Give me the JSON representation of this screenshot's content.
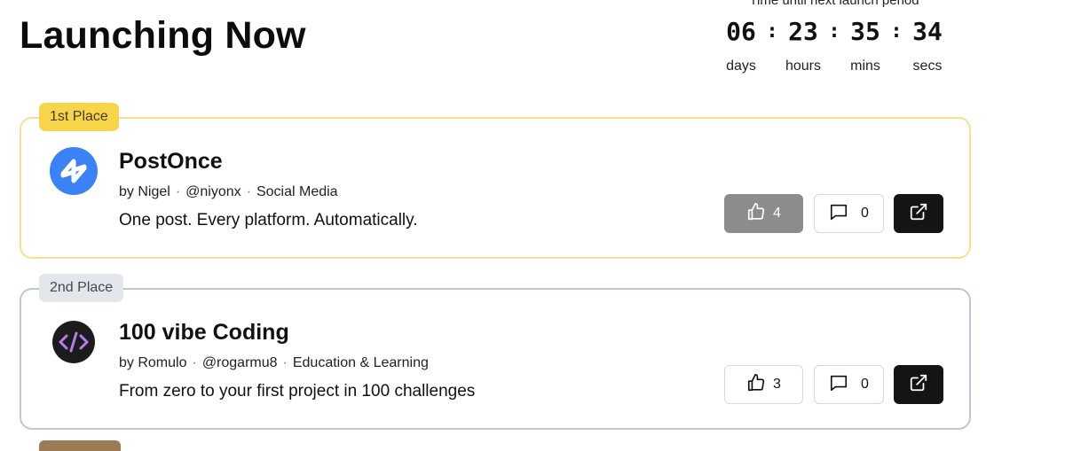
{
  "page": {
    "title": "Launching Now"
  },
  "countdown": {
    "caption": "Time until next launch period",
    "units": [
      {
        "value": "06",
        "label": "days"
      },
      {
        "value": "23",
        "label": "hours"
      },
      {
        "value": "35",
        "label": "mins"
      },
      {
        "value": "34",
        "label": "secs"
      }
    ],
    "separator": ":"
  },
  "launches": [
    {
      "place": "1st Place",
      "name": "PostOnce",
      "author": "by Nigel",
      "handle": "@niyonx",
      "category": "Social Media",
      "tagline": "One post. Every platform. Automatically.",
      "upvotes": "4",
      "upvoted": true,
      "comments": "0",
      "logo_icon": "postonce-logo-icon",
      "badge_color": "#f7d54a",
      "border_color": "#f9de93"
    },
    {
      "place": "2nd Place",
      "name": "100 vibe Coding",
      "author": "by Romulo",
      "handle": "@rogarmu8",
      "category": "Education & Learning",
      "tagline": "From zero to your first project in 100 challenges",
      "upvotes": "3",
      "upvoted": false,
      "comments": "0",
      "logo_icon": "code-brackets-icon",
      "badge_color": "#e3e6ea",
      "border_color": "#bfc7d0"
    }
  ],
  "colors": {
    "upvote_active": "#8c8c8c",
    "visit_button": "#141414",
    "bronze_badge": "#9b7a54"
  }
}
